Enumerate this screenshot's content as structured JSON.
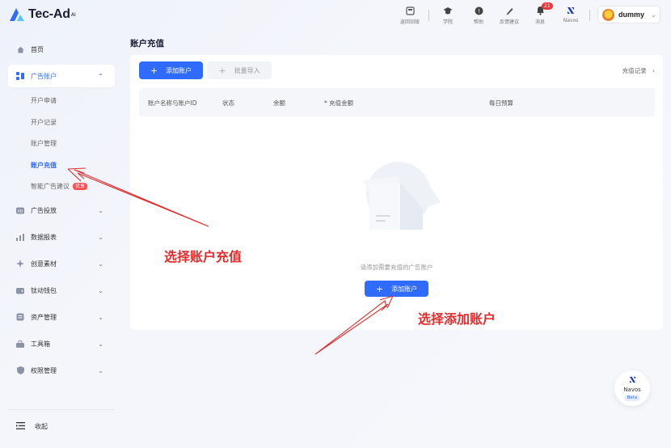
{
  "brand": {
    "name": "Tec-Ad",
    "sup": "AI"
  },
  "header": {
    "tools": [
      {
        "label": "返回旧版",
        "icon": "grid-box-icon"
      },
      {
        "label": "学院",
        "icon": "graduation-cap-icon"
      },
      {
        "label": "帮助",
        "icon": "help-circle-icon"
      },
      {
        "label": "反馈建议",
        "icon": "pencil-icon"
      },
      {
        "label": "消息",
        "icon": "bell-icon",
        "badge": "21"
      },
      {
        "label": "Navos",
        "icon": "navos-logo-icon"
      }
    ],
    "user": {
      "name": "dummy"
    }
  },
  "sidebar": {
    "items": [
      {
        "label": "首页",
        "icon": "home-icon"
      },
      {
        "label": "广告账户",
        "icon": "ad-account-icon",
        "expanded": true
      },
      {
        "label": "广告投放",
        "icon": "ad-delivery-icon"
      },
      {
        "label": "数据报表",
        "icon": "bar-chart-icon"
      },
      {
        "label": "创意素材",
        "icon": "creative-icon"
      },
      {
        "label": "钛动钱包",
        "icon": "wallet-icon"
      },
      {
        "label": "资产管理",
        "icon": "asset-icon"
      },
      {
        "label": "工具箱",
        "icon": "toolbox-icon"
      },
      {
        "label": "权限管理",
        "icon": "shield-icon"
      }
    ],
    "sub_items": [
      {
        "label": "开户申请"
      },
      {
        "label": "开户记录"
      },
      {
        "label": "账户管理"
      },
      {
        "label": "账户充值",
        "active": true
      },
      {
        "label": "智能广告建议",
        "badge": "优享"
      }
    ],
    "collapse_label": "收起"
  },
  "main": {
    "title": "账户充值",
    "add_account_label": "添加账户",
    "batch_import_label": "批量导入",
    "record_link_label": "充值记录",
    "columns": [
      "账户名称与账户ID",
      "状态",
      "余额",
      "* 充值金额",
      "每日预算"
    ],
    "empty_text": "请添加需要充值的广告账户",
    "empty_button_label": "添加账户"
  },
  "annotations": {
    "select_recharge": "选择账户充值",
    "select_add": "选择添加账户"
  },
  "navos_float": {
    "label": "Navos",
    "badge": "Beta"
  },
  "colors": {
    "primary": "#2f6bff",
    "annotation": "#e32b2b",
    "badge": "#e8383b"
  }
}
